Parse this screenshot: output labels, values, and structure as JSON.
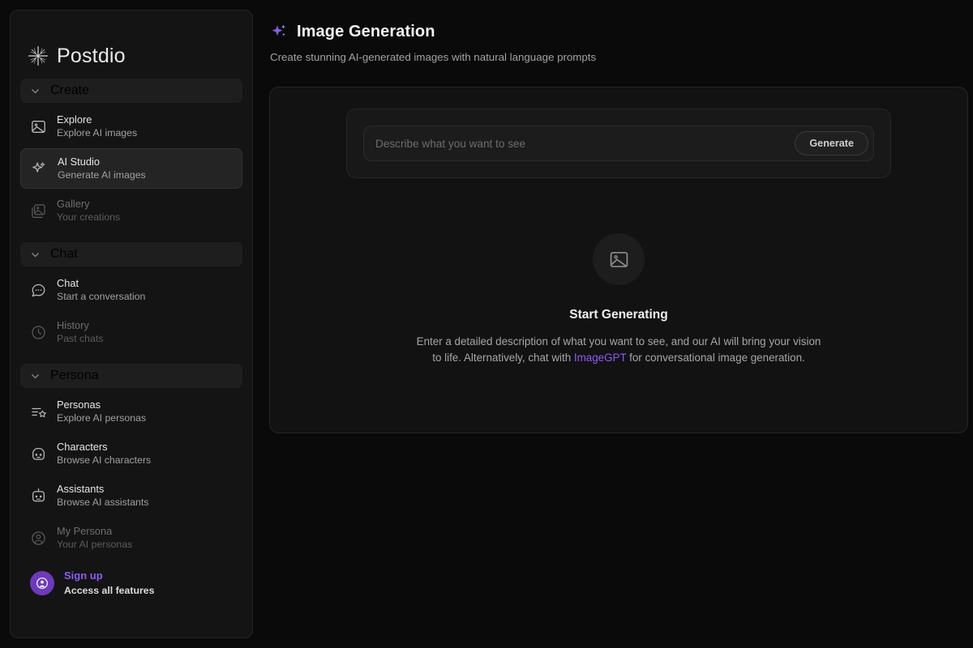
{
  "brand": {
    "name": "Postdio",
    "logo_icon": "starburst-icon"
  },
  "sidebar": {
    "sections": [
      {
        "id": "create",
        "title": "Create",
        "chevron_icon": "chevron-down-icon",
        "items": [
          {
            "id": "explore",
            "label": "Explore",
            "sub": "Explore AI images",
            "icon": "image-icon",
            "state": "normal"
          },
          {
            "id": "ai-studio",
            "label": "AI Studio",
            "sub": "Generate AI images",
            "icon": "sparkles-icon",
            "state": "active"
          },
          {
            "id": "gallery",
            "label": "Gallery",
            "sub": "Your creations",
            "icon": "images-stack-icon",
            "state": "dim"
          }
        ]
      },
      {
        "id": "chat",
        "title": "Chat",
        "chevron_icon": "chevron-down-icon",
        "items": [
          {
            "id": "chat",
            "label": "Chat",
            "sub": "Start a conversation",
            "icon": "chat-bubble-icon",
            "state": "normal"
          },
          {
            "id": "history",
            "label": "History",
            "sub": "Past chats",
            "icon": "clock-icon",
            "state": "dim"
          }
        ]
      },
      {
        "id": "persona",
        "title": "Persona",
        "chevron_icon": "chevron-down-icon",
        "items": [
          {
            "id": "personas",
            "label": "Personas",
            "sub": "Explore AI personas",
            "icon": "list-star-icon",
            "state": "normal"
          },
          {
            "id": "characters",
            "label": "Characters",
            "sub": "Browse AI characters",
            "icon": "robot-face-icon",
            "state": "normal"
          },
          {
            "id": "assistants",
            "label": "Assistants",
            "sub": "Browse AI assistants",
            "icon": "robot-antenna-icon",
            "state": "normal"
          },
          {
            "id": "my-persona",
            "label": "My Persona",
            "sub": "Your AI personas",
            "icon": "user-circle-icon",
            "state": "dim"
          }
        ]
      }
    ],
    "signup": {
      "label": "Sign up",
      "sub": "Access all features",
      "avatar_icon": "user-avatar-icon",
      "accent_color": "#8b5cf6",
      "avatar_bg": "#6d39bd"
    }
  },
  "main": {
    "header": {
      "icon": "sparkles-icon",
      "icon_color": "#8b5cf6",
      "title": "Image Generation",
      "subtitle": "Create stunning AI-generated images with natural language prompts"
    },
    "prompt": {
      "placeholder": "Describe what you want to see",
      "value": "",
      "generate_label": "Generate"
    },
    "empty_state": {
      "icon": "image-placeholder-icon",
      "title": "Start Generating",
      "desc_before": "Enter a detailed description of what you want to see, and our AI will bring your vision to life. Alternatively, chat with ",
      "link_text": "ImageGPT",
      "desc_after": " for conversational image generation."
    }
  },
  "colors": {
    "page_bg": "#0a0a0a",
    "sidebar_bg": "#141414",
    "card_bg": "#121212",
    "accent": "#8b5cf6"
  }
}
